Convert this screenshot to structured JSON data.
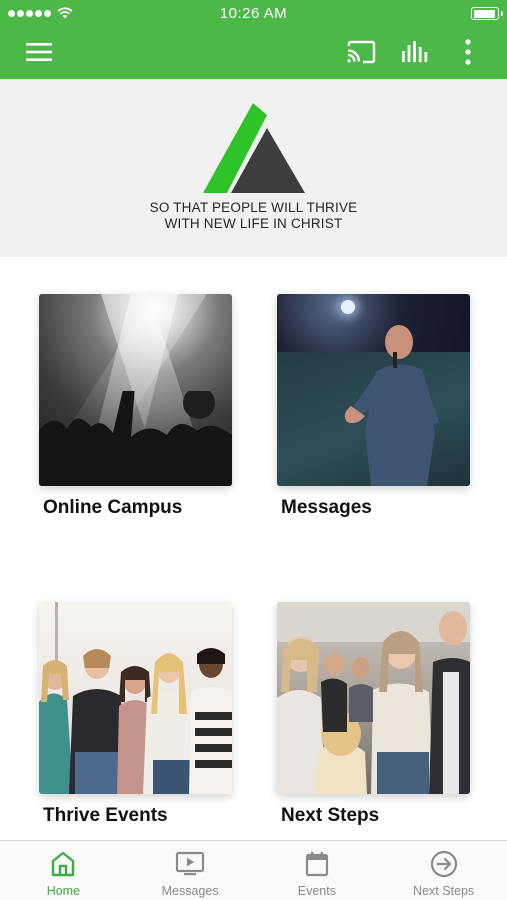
{
  "status_bar": {
    "time": "10:26 AM"
  },
  "header": {
    "menu_icon": "hamburger-menu-icon",
    "cast_icon": "cast-icon",
    "audio_icon": "equalizer-icon",
    "more_icon": "more-vertical-icon"
  },
  "hero": {
    "tagline_line1": "SO THAT PEOPLE WILL THRIVE",
    "tagline_line2": "WITH NEW LIFE IN CHRIST"
  },
  "tiles": [
    {
      "label": "Online Campus"
    },
    {
      "label": "Messages"
    },
    {
      "label": "Thrive Events"
    },
    {
      "label": "Next Steps"
    }
  ],
  "bottom_nav": [
    {
      "label": "Home",
      "icon": "home-icon",
      "active": true
    },
    {
      "label": "Messages",
      "icon": "tv-play-icon",
      "active": false
    },
    {
      "label": "Events",
      "icon": "calendar-icon",
      "active": false
    },
    {
      "label": "Next Steps",
      "icon": "arrow-circle-right-icon",
      "active": false
    }
  ],
  "colors": {
    "brand_green": "#4cb848",
    "active_tab": "#3fab44",
    "inactive_tab": "#8a8a8a",
    "logo_dark": "#3a3a3a"
  }
}
